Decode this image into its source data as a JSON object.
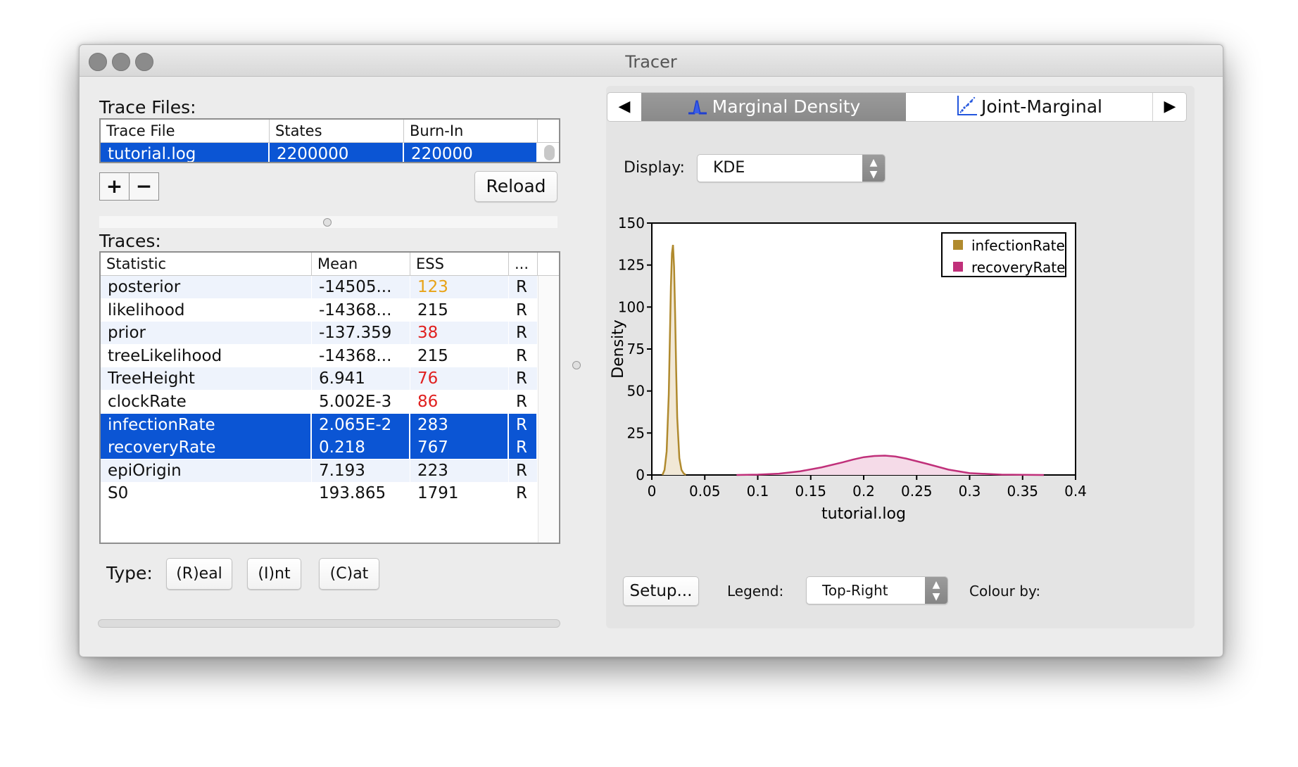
{
  "window": {
    "title": "Tracer"
  },
  "trace_files": {
    "label": "Trace Files:",
    "columns": [
      "Trace File",
      "States",
      "Burn-In"
    ],
    "rows": [
      {
        "file": "tutorial.log",
        "states": "2200000",
        "burnin": "220000"
      }
    ],
    "add_label": "+",
    "remove_label": "−",
    "reload_label": "Reload"
  },
  "traces": {
    "label": "Traces:",
    "columns": [
      "Statistic",
      "Mean",
      "ESS",
      "..."
    ],
    "rows": [
      {
        "stat": "posterior",
        "mean": "-14505...",
        "ess": "123",
        "type": "R",
        "ess_color": "#e8a317",
        "selected": false
      },
      {
        "stat": "likelihood",
        "mean": "-14368...",
        "ess": "215",
        "type": "R",
        "ess_color": "#111111",
        "selected": false
      },
      {
        "stat": "prior",
        "mean": "-137.359",
        "ess": "38",
        "type": "R",
        "ess_color": "#e0201f",
        "selected": false
      },
      {
        "stat": "treeLikelihood",
        "mean": "-14368...",
        "ess": "215",
        "type": "R",
        "ess_color": "#111111",
        "selected": false
      },
      {
        "stat": "TreeHeight",
        "mean": "6.941",
        "ess": "76",
        "type": "R",
        "ess_color": "#e0201f",
        "selected": false
      },
      {
        "stat": "clockRate",
        "mean": "5.002E-3",
        "ess": "86",
        "type": "R",
        "ess_color": "#e0201f",
        "selected": false
      },
      {
        "stat": "infectionRate",
        "mean": "2.065E-2",
        "ess": "283",
        "type": "R",
        "ess_color": "#ffffff",
        "selected": true
      },
      {
        "stat": "recoveryRate",
        "mean": "0.218",
        "ess": "767",
        "type": "R",
        "ess_color": "#ffffff",
        "selected": true
      },
      {
        "stat": "epiOrigin",
        "mean": "7.193",
        "ess": "223",
        "type": "R",
        "ess_color": "#111111",
        "selected": false
      },
      {
        "stat": "S0",
        "mean": "193.865",
        "ess": "1791",
        "type": "R",
        "ess_color": "#111111",
        "selected": false
      }
    ],
    "type_label": "Type:",
    "type_buttons": [
      "(R)eal",
      "(I)nt",
      "(C)at"
    ]
  },
  "tabs": {
    "prev_icon": "◀",
    "next_icon": "▶",
    "items": [
      {
        "label": "Marginal Density",
        "icon": "density-icon",
        "active": true
      },
      {
        "label": "Joint-Marginal",
        "icon": "joint-marginal-icon",
        "active": false
      }
    ]
  },
  "display": {
    "label": "Display:",
    "value": "KDE"
  },
  "bottom_controls": {
    "setup_label": "Setup...",
    "legend_label": "Legend:",
    "legend_value": "Top-Right",
    "colour_by_label": "Colour by:"
  },
  "chart_data": {
    "type": "area",
    "xlabel": "tutorial.log",
    "ylabel": "Density",
    "xlim": [
      0,
      0.4
    ],
    "ylim": [
      0,
      150
    ],
    "x_ticks": [
      "0",
      "0.05",
      "0.1",
      "0.15",
      "0.2",
      "0.25",
      "0.3",
      "0.35",
      "0.4"
    ],
    "y_ticks": [
      "0",
      "25",
      "50",
      "75",
      "100",
      "125",
      "150"
    ],
    "legend_position": "top-right",
    "series": [
      {
        "name": "infectionRate",
        "color": "#b08a2e",
        "fill": "#f1e8d6",
        "x": [
          0.01,
          0.012,
          0.014,
          0.016,
          0.017,
          0.018,
          0.019,
          0.02,
          0.021,
          0.022,
          0.023,
          0.024,
          0.026,
          0.028,
          0.03,
          0.032
        ],
        "y": [
          0,
          3,
          14,
          48,
          80,
          112,
          132,
          137,
          124,
          96,
          62,
          34,
          10,
          3,
          1,
          0
        ]
      },
      {
        "name": "recoveryRate",
        "color": "#c0307a",
        "fill": "#f5dbe8",
        "x": [
          0.08,
          0.1,
          0.12,
          0.14,
          0.16,
          0.18,
          0.19,
          0.2,
          0.21,
          0.22,
          0.23,
          0.24,
          0.26,
          0.28,
          0.3,
          0.33,
          0.37
        ],
        "y": [
          0,
          0.2,
          0.8,
          2.2,
          4.5,
          7.5,
          9.2,
          10.6,
          11.3,
          11.5,
          11.0,
          9.8,
          6.6,
          3.2,
          1.1,
          0.2,
          0
        ]
      }
    ]
  }
}
